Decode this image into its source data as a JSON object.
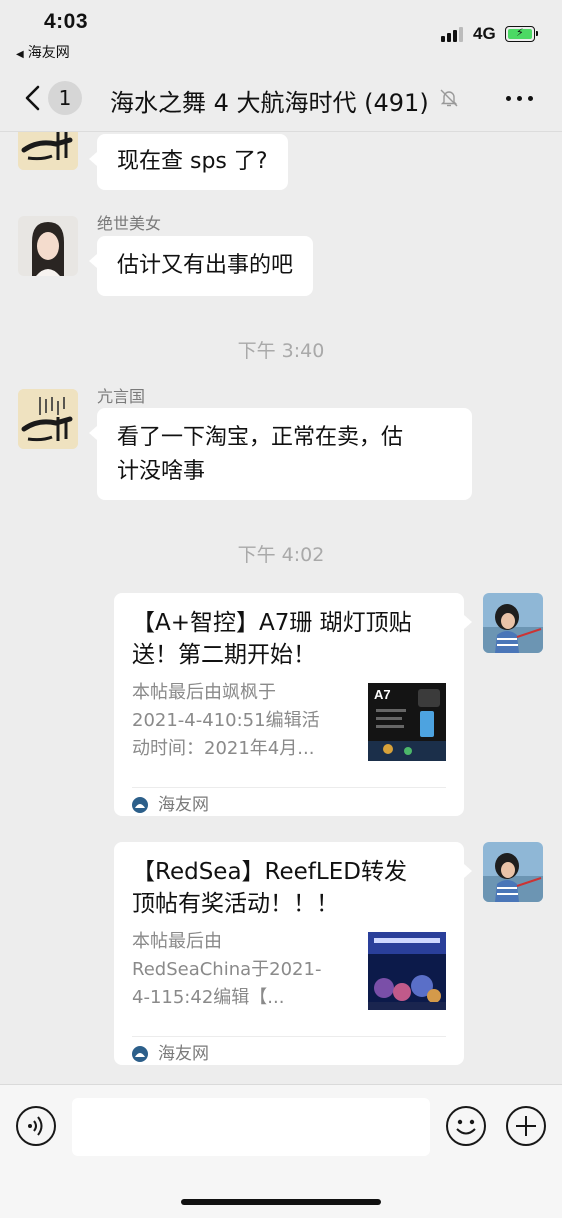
{
  "status_bar": {
    "time": "4:03",
    "back_app": "海友网",
    "network": "4G"
  },
  "nav": {
    "title": "海水之舞 4 大航海时代 (491)",
    "back_count": "1"
  },
  "messages": [
    {
      "type": "text",
      "sender": "",
      "avatar": "calligraphy-avatar",
      "text": "现在查 sps 了?"
    },
    {
      "type": "text",
      "sender": "绝世美女",
      "avatar": "woman-avatar",
      "text": "估计又有出事的吧"
    },
    {
      "type": "time",
      "text": "下午 3:40"
    },
    {
      "type": "text",
      "sender": "亢言国",
      "avatar": "calligraphy-avatar",
      "text_lines": [
        "看了一下淘宝，正常在卖，估",
        "计没啥事"
      ]
    },
    {
      "type": "time",
      "text": "下午 4:02"
    },
    {
      "type": "card",
      "avatar": "child-avatar",
      "title_lines": [
        "【A+智控】A7珊 瑚灯顶贴",
        "送！第二期开始！"
      ],
      "desc_lines": [
        "本帖最后由飒枫于",
        "2021-4-410:51编辑活",
        "动时间：2021年4月..."
      ],
      "thumb_label": "A7",
      "source": "海友网"
    },
    {
      "type": "card",
      "avatar": "child-avatar",
      "title_lines": [
        "【RedSea】ReefLED转发",
        "顶帖有奖活动！！！"
      ],
      "desc_lines": [
        "本帖最后由",
        "RedSeaChina于2021-",
        "4-115:42编辑【..."
      ],
      "source": "海友网"
    }
  ],
  "input": {
    "placeholder": ""
  },
  "colors": {
    "background": "#ededed",
    "bubble": "#ffffff",
    "battery": "#4cd964"
  }
}
